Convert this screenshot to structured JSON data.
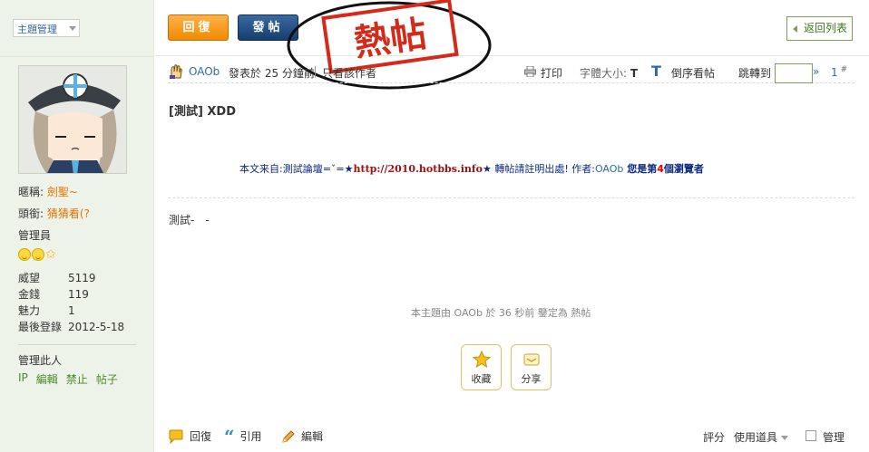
{
  "sidebar": {
    "manage_select": "主題管理",
    "nickname_label": "暱稱:",
    "nickname_value": "劍聖~",
    "title_label": "頭銜:",
    "title_value": "猜猜看(?",
    "group": "管理員",
    "stats": [
      {
        "label": "威望",
        "value": "5119"
      },
      {
        "label": "金錢",
        "value": "119"
      },
      {
        "label": "魅力",
        "value": "1"
      },
      {
        "label": "最後登錄",
        "value": "2012-5-18"
      }
    ],
    "manage_user": "管理此人",
    "admin_links": [
      "IP",
      "編輯",
      "禁止",
      "帖子"
    ]
  },
  "toolbar": {
    "reply_label": "回復",
    "post_label": "發帖",
    "back_list": "返回列表",
    "stamp_text": "熱帖"
  },
  "post": {
    "author": "OAOb",
    "posted_at": "發表於 25 分鐘前",
    "only_author": "只看該作者",
    "print": "打印",
    "font_size_label": "字體大小:",
    "font_size_t": "T",
    "font_size_big": "T",
    "reverse": "倒序看帖",
    "jump_to": "跳轉到",
    "jump_go": "»",
    "floor": "1",
    "floor_mark": "#",
    "title": "[測試] XDD",
    "source_prefix": "本文来自:測試論壇=ˇ=★",
    "source_url": "http://2010.hotbbs.info",
    "source_star": "★",
    "source_mid": " 轉帖請註明出處! 作者:",
    "source_author": "OAOb",
    "source_pre_count": " 您是第",
    "source_count": "4",
    "source_post_count": "個瀏覽者",
    "body": "測試-　-",
    "mod_log": "本主題由 OAOb 於 36 秒前 鑒定為 熱帖",
    "favorite": "收藏",
    "share": "分享"
  },
  "bottom": {
    "reply": "回復",
    "quote": "引用",
    "edit": "編輯",
    "rate": "評分",
    "tools": "使用道具",
    "manage": "管理"
  },
  "colors": {
    "sidebar_bg": "#eef3ea",
    "reply_orange": "#f08a00",
    "post_blue": "#163e6e",
    "link_blue": "#2b6ca8",
    "stamp_red": "#d42a1a"
  }
}
